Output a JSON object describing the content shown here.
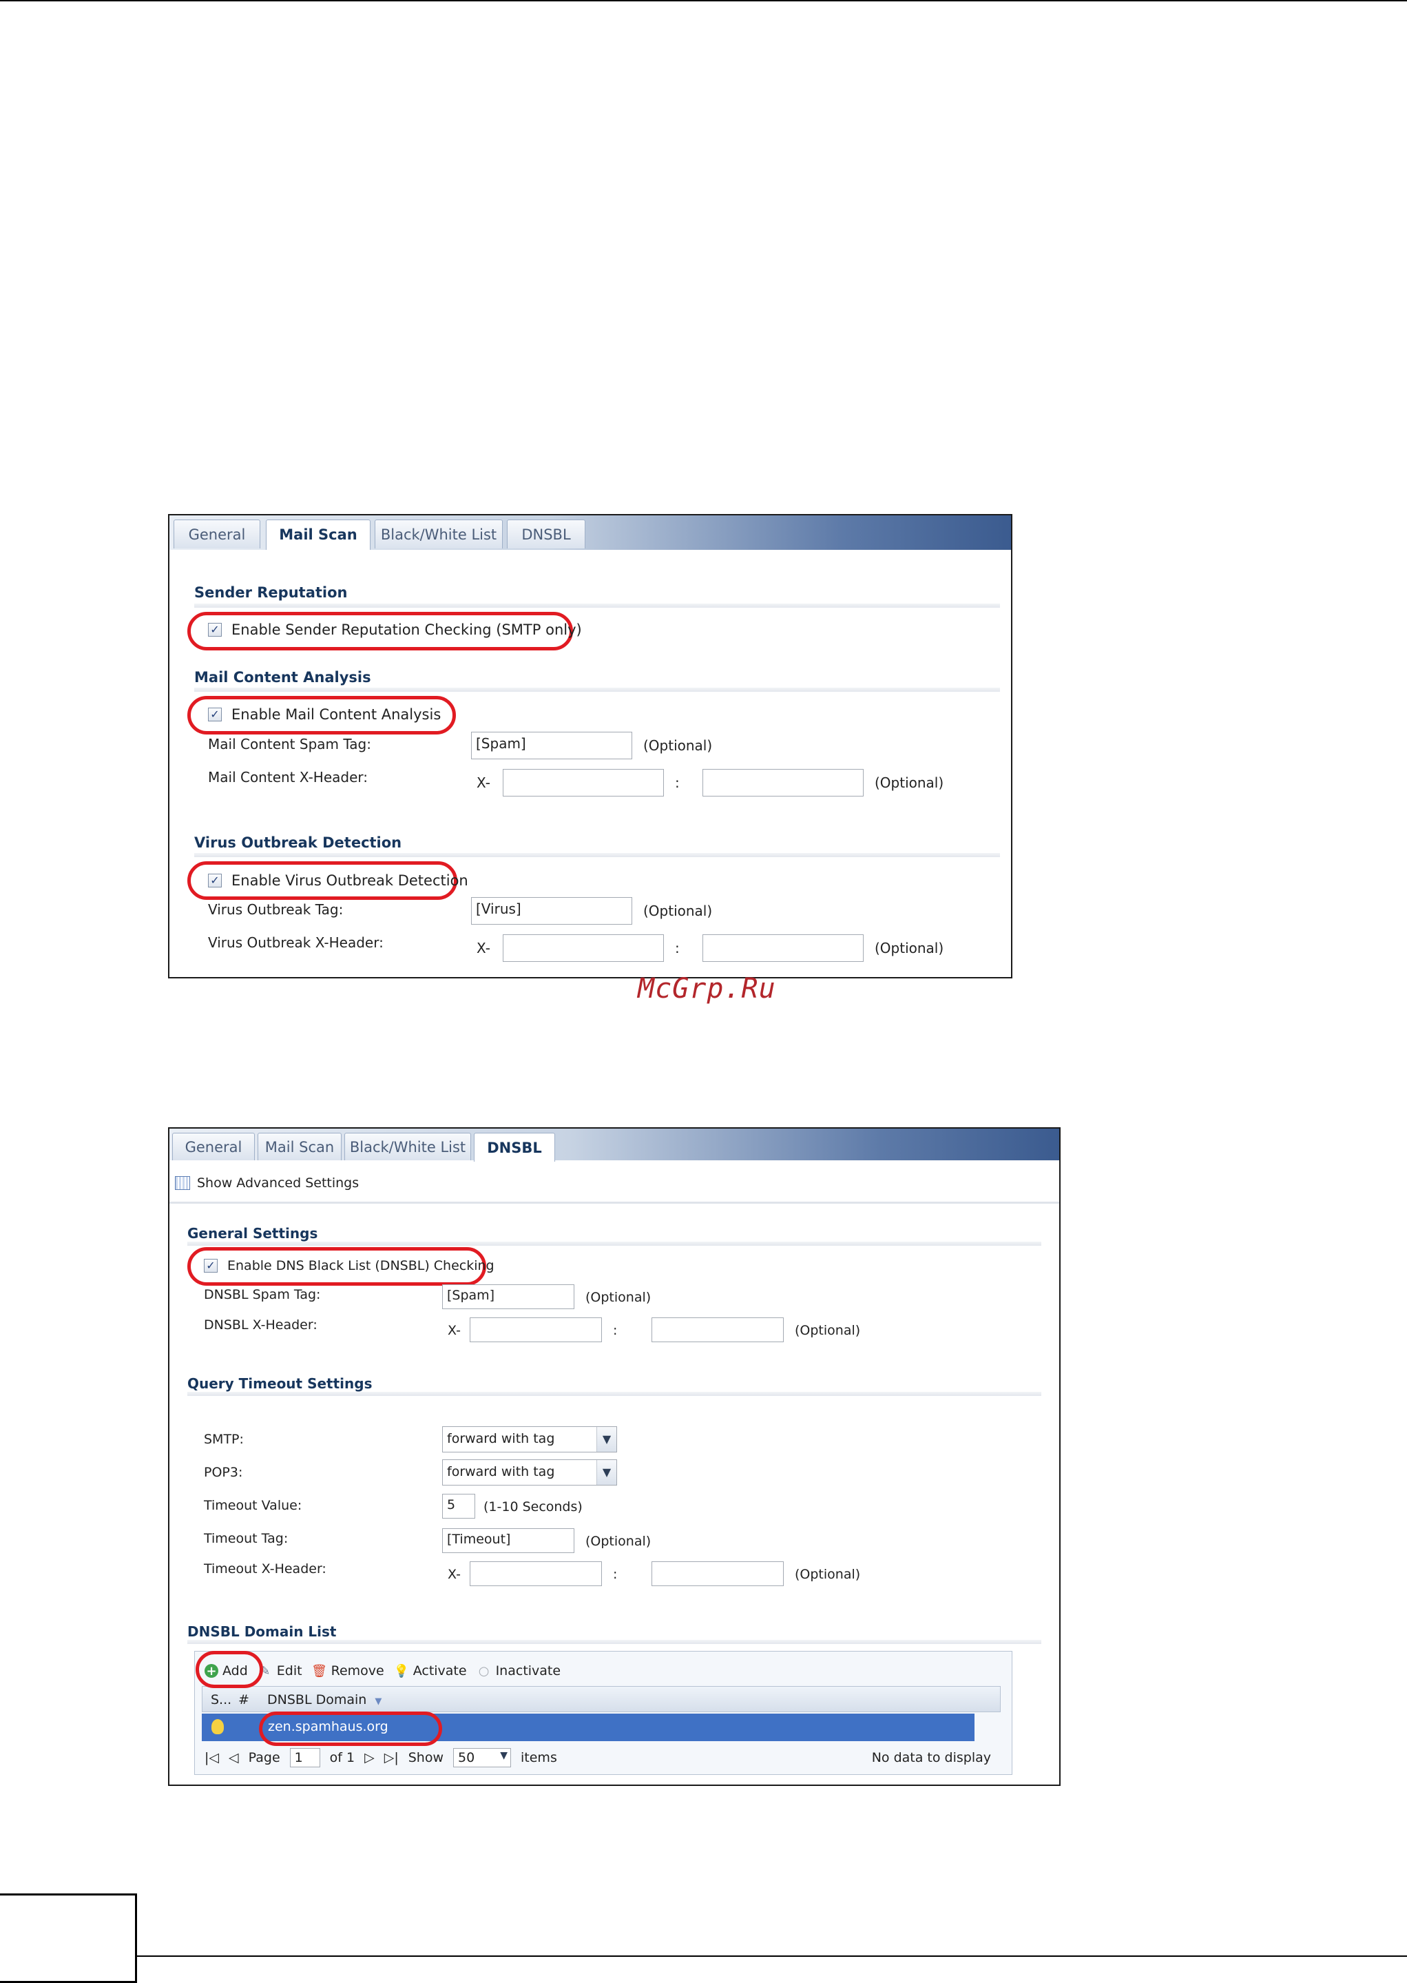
{
  "watermark": "McGrp.Ru",
  "panel1": {
    "tabs": [
      "General",
      "Mail Scan",
      "Black/White List",
      "DNSBL"
    ],
    "active_tab": "Mail Scan",
    "sender_reputation": {
      "title": "Sender Reputation",
      "enable_label": "Enable Sender Reputation Checking (SMTP only)"
    },
    "mail_content": {
      "title": "Mail Content Analysis",
      "enable_label": "Enable Mail Content Analysis",
      "spam_tag_label": "Mail Content Spam Tag:",
      "spam_tag_value": "[Spam]",
      "optional": "(Optional)",
      "xheader_label": "Mail Content X-Header:",
      "x_prefix": "X-",
      "colon": ":"
    },
    "virus": {
      "title": "Virus Outbreak Detection",
      "enable_label": "Enable Virus Outbreak Detection",
      "tag_label": "Virus Outbreak Tag:",
      "tag_value": "[Virus]",
      "optional": "(Optional)",
      "xheader_label": "Virus Outbreak X-Header:",
      "x_prefix": "X-",
      "colon": ":"
    }
  },
  "panel2": {
    "tabs": [
      "General",
      "Mail Scan",
      "Black/White List",
      "DNSBL"
    ],
    "active_tab": "DNSBL",
    "show_advanced": "Show Advanced Settings",
    "general": {
      "title": "General Settings",
      "enable_label": "Enable DNS Black List (DNSBL) Checking",
      "spam_tag_label": "DNSBL Spam Tag:",
      "spam_tag_value": "[Spam]",
      "optional": "(Optional)",
      "xheader_label": "DNSBL X-Header:",
      "x_prefix": "X-",
      "colon": ":"
    },
    "query": {
      "title": "Query Timeout Settings",
      "smtp_label": "SMTP:",
      "smtp_value": "forward with tag",
      "pop3_label": "POP3:",
      "pop3_value": "forward with tag",
      "timeout_value_label": "Timeout Value:",
      "timeout_value": "5",
      "timeout_unit": "(1-10 Seconds)",
      "timeout_tag_label": "Timeout Tag:",
      "timeout_tag_value": "[Timeout]",
      "optional": "(Optional)",
      "timeout_xheader_label": "Timeout X-Header:",
      "x_prefix": "X-",
      "colon": ":"
    },
    "domain_list": {
      "title": "DNSBL Domain List",
      "toolbar": {
        "add": "Add",
        "edit": "Edit",
        "remove": "Remove",
        "activate": "Activate",
        "inactivate": "Inactivate"
      },
      "columns": [
        "S...",
        "#",
        "DNSBL Domain"
      ],
      "rows": [
        {
          "domain": "zen.spamhaus.org"
        }
      ],
      "pager": {
        "page_label": "Page",
        "page_value": "1",
        "of_label": "of 1",
        "show_label": "Show",
        "show_value": "50",
        "items_label": "items",
        "status": "No data to display"
      }
    }
  },
  "colors": {
    "highlight_ring": "#e11b22",
    "section_title": "#17365d",
    "selected_row": "#3f71c5"
  }
}
